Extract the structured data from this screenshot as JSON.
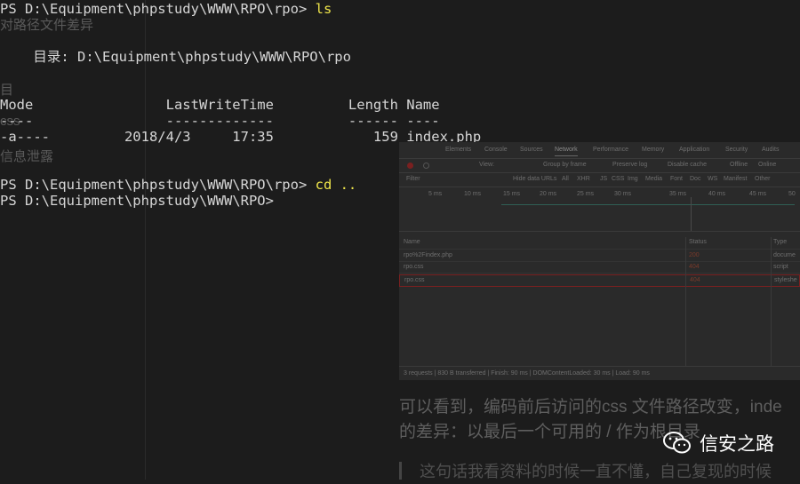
{
  "terminal": {
    "line1_prompt": "PS D:\\Equipment\\phpstudy\\WWW\\RPO\\rpo> ",
    "line1_cmd": "ls",
    "dir_label": "    目录: D:\\Equipment\\phpstudy\\WWW\\RPO\\rpo",
    "header": "Mode                LastWriteTime         Length Name",
    "underline": "----                -------------         ------ ----",
    "file_row": "-a----         2018/4/3     17:35            159 index.php",
    "line2_prompt": "PS D:\\Equipment\\phpstudy\\WWW\\RPO\\rpo> ",
    "line2_cmd": "cd ..",
    "line3_prompt": "PS D:\\Equipment\\phpstudy\\WWW\\RPO> "
  },
  "background_text": {
    "t1": "对路径文件差异",
    "t2": "目",
    "t3": "css",
    "t4": "信息泄露"
  },
  "devtools": {
    "tabs": [
      "Elements",
      "Console",
      "Sources",
      "Network",
      "Performance",
      "Memory",
      "Application",
      "Security",
      "Audits"
    ],
    "toolbar": [
      "View:",
      "Group by frame",
      "Preserve log",
      "Disable cache",
      "Offline",
      "Online"
    ],
    "filter": [
      "Filter",
      "Hide data URLs",
      "All",
      "XHR",
      "JS",
      "CSS",
      "Img",
      "Media",
      "Font",
      "Doc",
      "WS",
      "Manifest",
      "Other"
    ],
    "ticks": [
      "5 ms",
      "10 ms",
      "15 ms",
      "20 ms",
      "25 ms",
      "30 ms",
      "35 ms",
      "40 ms",
      "45 ms",
      "50"
    ],
    "columns": [
      "Name",
      "Status",
      "Type"
    ],
    "rows": [
      {
        "name": "rpo%2Findex.php",
        "status": "200",
        "type": "docume"
      },
      {
        "name": "rpo.css",
        "status": "404",
        "type": "script"
      },
      {
        "name": "rpo.css",
        "status": "404",
        "type": "styleshe"
      }
    ],
    "statusbar": "3 requests  |  830 B transferred  |  Finish: 90 ms  |  DOMContentLoaded: 30 ms  |  Load: 90 ms"
  },
  "article": {
    "line1": "可以看到，编码前后访问的css 文件路径改变，inde",
    "line2": "的差异：以最后一个可用的 / 作为根目录",
    "line3": "这句话我看资料的时候一直不懂，自己复现的时候"
  },
  "watermark": {
    "label": "信安之路",
    "icon": "wechat-icon"
  },
  "colors": {
    "background": "#1c1c1c",
    "command": "#f0e64a",
    "text": "#d6d6d6"
  }
}
